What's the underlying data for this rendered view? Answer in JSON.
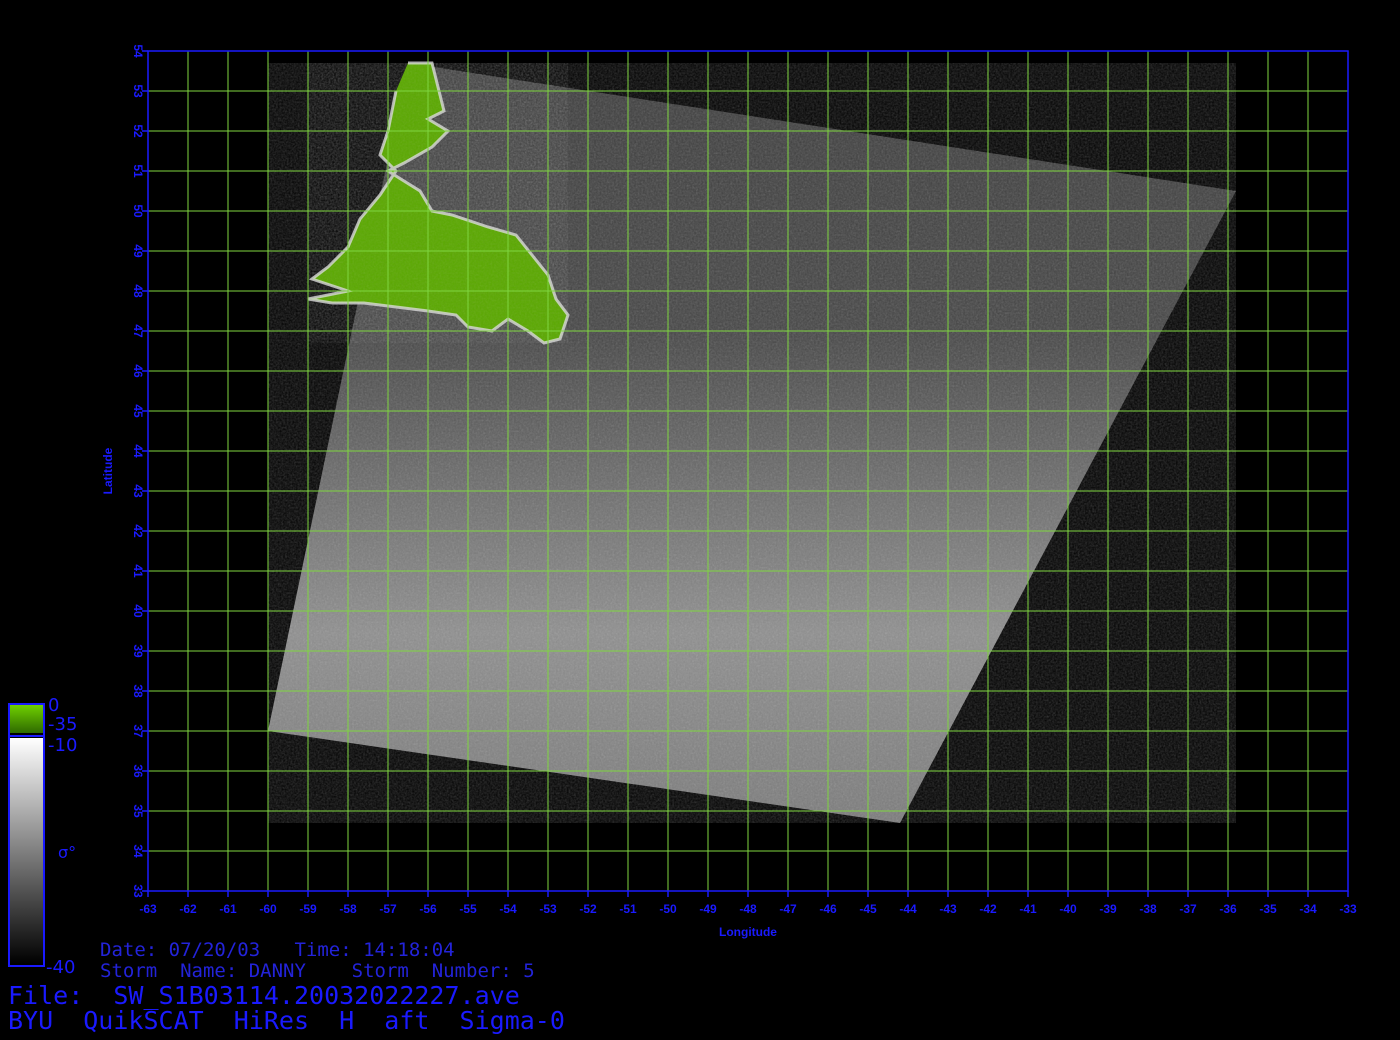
{
  "map": {
    "lon_range": [
      -63,
      -33
    ],
    "lat_range": [
      33,
      54
    ],
    "lon_ticks": [
      "-63",
      "-62",
      "-61",
      "-60",
      "-59",
      "-58",
      "-57",
      "-56",
      "-55",
      "-54",
      "-53",
      "-52",
      "-51",
      "-50",
      "-49",
      "-48",
      "-47",
      "-46",
      "-45",
      "-44",
      "-43",
      "-42",
      "-41",
      "-40",
      "-39",
      "-38",
      "-37",
      "-36",
      "-35",
      "-34",
      "-33"
    ],
    "lat_ticks": [
      "33",
      "34",
      "35",
      "36",
      "37",
      "38",
      "39",
      "40",
      "41",
      "42",
      "43",
      "44",
      "45",
      "46",
      "47",
      "48",
      "49",
      "50",
      "51",
      "52",
      "53",
      "54"
    ],
    "xlabel": "Longitude",
    "ylabel": "Latitude",
    "grid": true,
    "grid_color": "#7fd640",
    "axis_color": "#1a1aff",
    "land_color": "#5aa800",
    "swath_corners_lonlat": [
      [
        -56.5,
        53.7
      ],
      [
        -35.8,
        50.5
      ],
      [
        -44.2,
        34.7
      ],
      [
        -60.0,
        37.0
      ]
    ]
  },
  "colorbar": {
    "land_top": "0",
    "land_bottom": "-35",
    "ocean_top": "-10",
    "ocean_bottom": "-40",
    "symbol": "σ°",
    "land_color": "#5aa800",
    "ocean_colors": [
      "#ffffff",
      "#000000"
    ]
  },
  "info": {
    "date_line": "Date: 07/20/03   Time: 14:18:04",
    "storm_line": "Storm  Name: DANNY    Storm  Number: 5",
    "file_line": "File:  SW_S1B03114.20032022227.ave",
    "title_line": "BYU  QuikSCAT  HiRes  H  aft  Sigma-0"
  }
}
